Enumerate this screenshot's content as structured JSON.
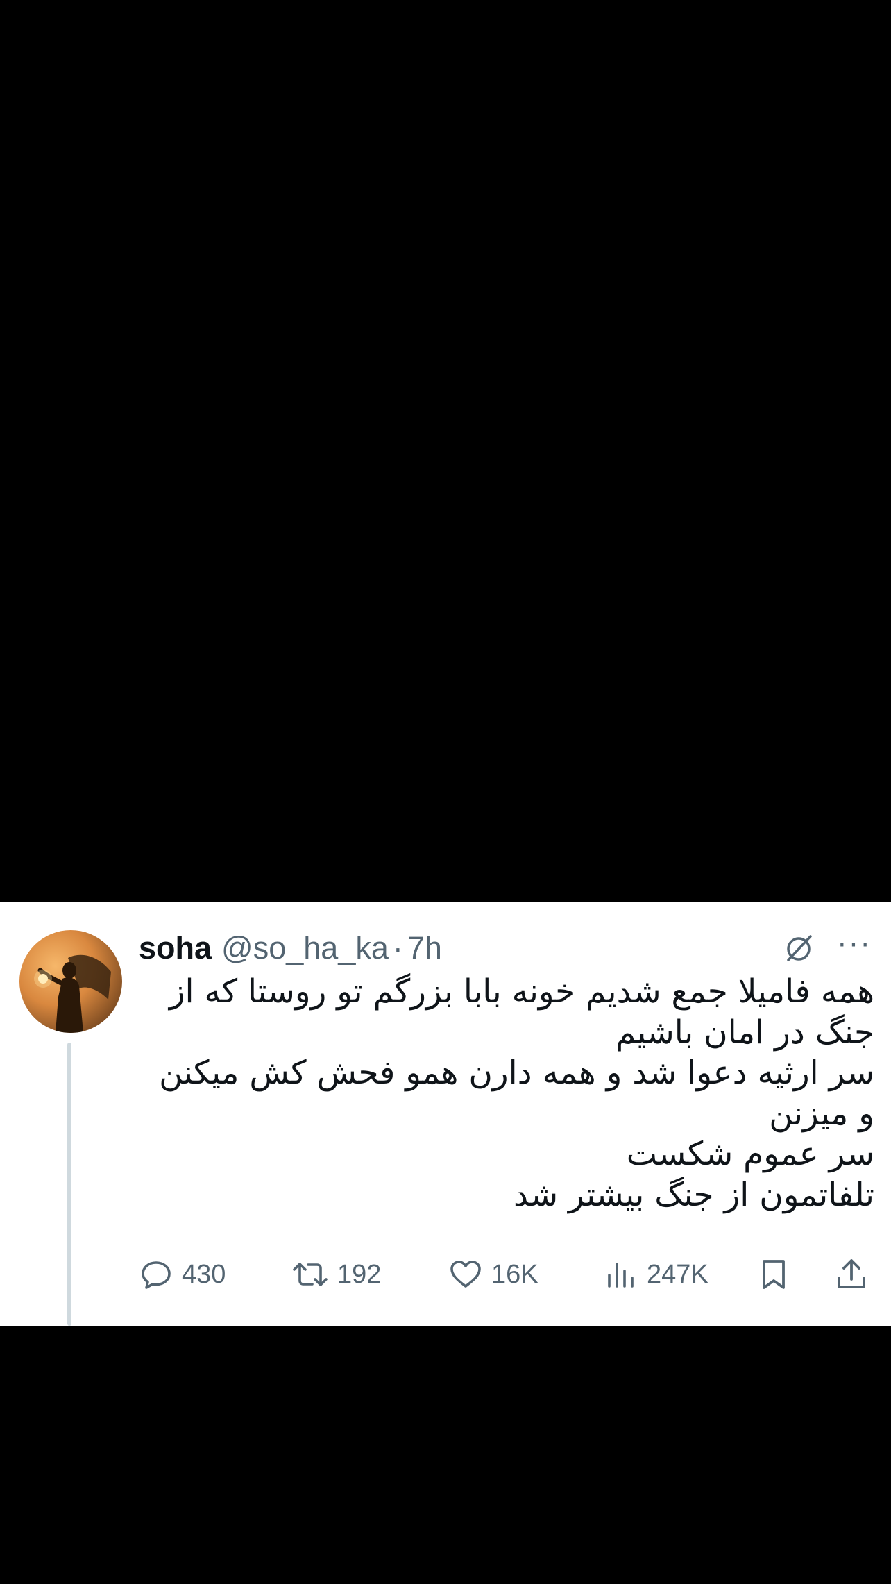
{
  "tweet": {
    "author_name": "soha",
    "handle": "@so_ha_ka",
    "separator": "·",
    "time": "7h",
    "text_lines": [
      "همه فامیلا جمع شدیم خونه بابا بزرگم تو روستا که از جنگ در امان باشیم",
      "سر ارثیه دعوا شد و همه دارن همو فحش کش میکنن و میزنن",
      "سر عموم شکست",
      "تلفاتمون از جنگ بیشتر شد"
    ],
    "actions": {
      "replies": "430",
      "reposts": "192",
      "likes": "16K",
      "views": "247K"
    }
  },
  "icons": {
    "reply": "reply-icon",
    "repost": "repost-icon",
    "like": "heart-icon",
    "views": "views-icon",
    "bookmark": "bookmark-icon",
    "share": "share-icon",
    "grok": "grok-icon",
    "more": "more-icon"
  },
  "colors": {
    "text_primary": "#0f1419",
    "text_secondary": "#536471",
    "background": "#ffffff",
    "letterbox": "#000000"
  }
}
